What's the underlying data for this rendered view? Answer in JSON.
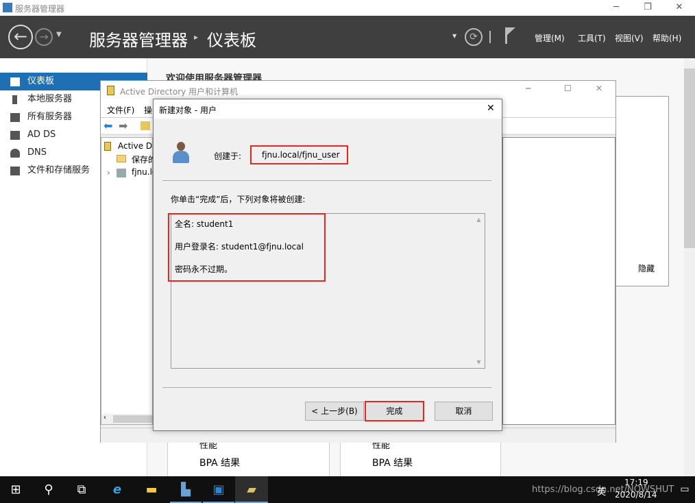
{
  "window": {
    "title": "服务器管理器",
    "minimize": "─",
    "maximize": "❐",
    "close": "✕"
  },
  "header": {
    "breadcrumb_root": "服务器管理器",
    "breadcrumb_sep": "▸",
    "breadcrumb_page": "仪表板",
    "menus": [
      "管理(M)",
      "工具(T)",
      "视图(V)",
      "帮助(H)"
    ]
  },
  "sidebar": {
    "items": [
      {
        "label": "仪表板",
        "selected": true
      },
      {
        "label": "本地服务器"
      },
      {
        "label": "所有服务器"
      },
      {
        "label": "AD DS"
      },
      {
        "label": "DNS"
      },
      {
        "label": "文件和存储服务"
      }
    ]
  },
  "main": {
    "welcome": "欢迎使用服务器管理器",
    "hide": "隐藏",
    "tiles": [
      {
        "perf": "性能",
        "bpa": "BPA 结果"
      },
      {
        "perf": "性能",
        "bpa": "BPA 结果"
      }
    ]
  },
  "ad_window": {
    "title": "Active Directory 用户和计算机",
    "menu": [
      "文件(F)",
      "操"
    ],
    "tree": [
      "Active Directory",
      "保存的",
      "fjnu.lo"
    ]
  },
  "dialog": {
    "title": "新建对象 - 用户",
    "created_in_label": "创建于:",
    "created_in_value": "fjnu.local/fjnu_user",
    "intro": "你单击“完成”后，下列对象将被创建:",
    "summary": [
      "全名: student1",
      "用户登录名: student1@fjnu.local",
      "密码永不过期。"
    ],
    "back": "< 上一步(B)",
    "finish": "完成",
    "cancel": "取消",
    "highlight_color": "#e8261e"
  },
  "taskbar": {
    "time": "17:19",
    "date": "2020/8/14",
    "ime": "英",
    "watermark": "https://blog.csdn.net/NOWSHUT"
  }
}
